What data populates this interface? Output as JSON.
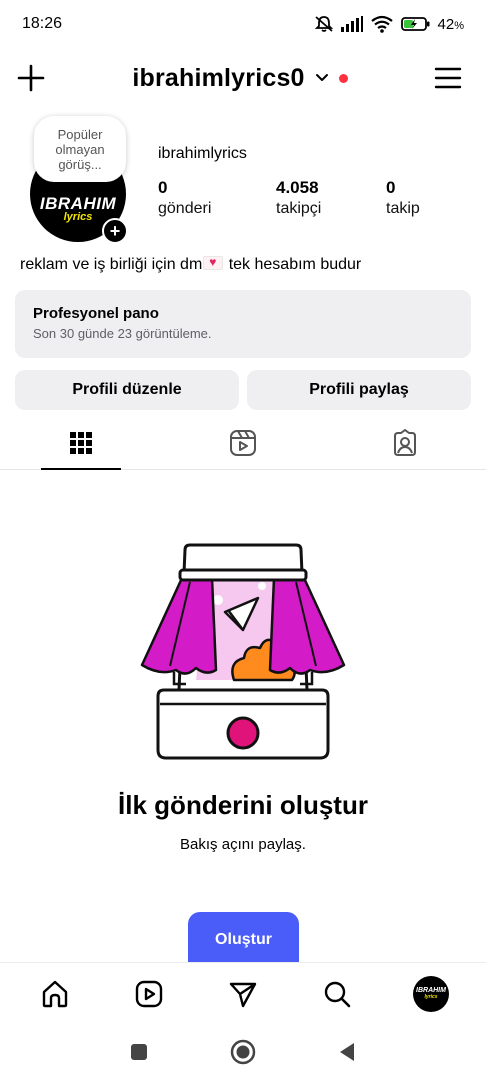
{
  "status_bar": {
    "time": "18:26",
    "battery_text": "42",
    "battery_unit": "%",
    "icons": [
      "mute-icon",
      "signal-icon",
      "wifi-icon",
      "battery-charging-icon"
    ]
  },
  "header": {
    "username": "ibrahimlyrics0",
    "icons": {
      "left": "plus-icon",
      "right": "menu-icon",
      "dropdown": "chevron-down-icon"
    },
    "notification_dot_color": "#ff3040"
  },
  "profile": {
    "note": "Popüler olmayan görüş...",
    "avatar_text": "IBRAHIM",
    "avatar_subtext": "lyrics",
    "display_name": "ibrahimlyrics",
    "stats": [
      {
        "value": "0",
        "label": "gönderi"
      },
      {
        "value": "4.058",
        "label": "takipçi"
      },
      {
        "value": "0",
        "label": "takip"
      }
    ],
    "bio_before": "reklam ve iş birliği için dm",
    "bio_after": " tek hesabım budur"
  },
  "pro_dashboard": {
    "title": "Profesyonel pano",
    "subtitle": "Son 30 günde 23 görüntüleme."
  },
  "buttons": {
    "edit_profile": "Profili düzenle",
    "share_profile": "Profili paylaş"
  },
  "tabs": [
    {
      "icon": "grid-icon",
      "active": true
    },
    {
      "icon": "reels-icon",
      "active": false
    },
    {
      "icon": "tagged-icon",
      "active": false
    }
  ],
  "empty_state": {
    "title": "İlk gönderini oluştur",
    "subtitle": "Bakış açını paylaş.",
    "button": "Oluştur"
  },
  "bottom_nav": {
    "items": [
      "home-icon",
      "reels-icon",
      "messages-icon",
      "search-icon",
      "profile-avatar"
    ],
    "avatar_text": "IBRAHIM",
    "avatar_subtext": "lyrics"
  },
  "system_nav": [
    "recents-icon",
    "home-icon",
    "back-icon"
  ],
  "colors": {
    "accent_blue": "#4a5df9",
    "magenta": "#d31bc8",
    "orange": "#ff8a1e",
    "pink_light": "#f7c8ef"
  }
}
